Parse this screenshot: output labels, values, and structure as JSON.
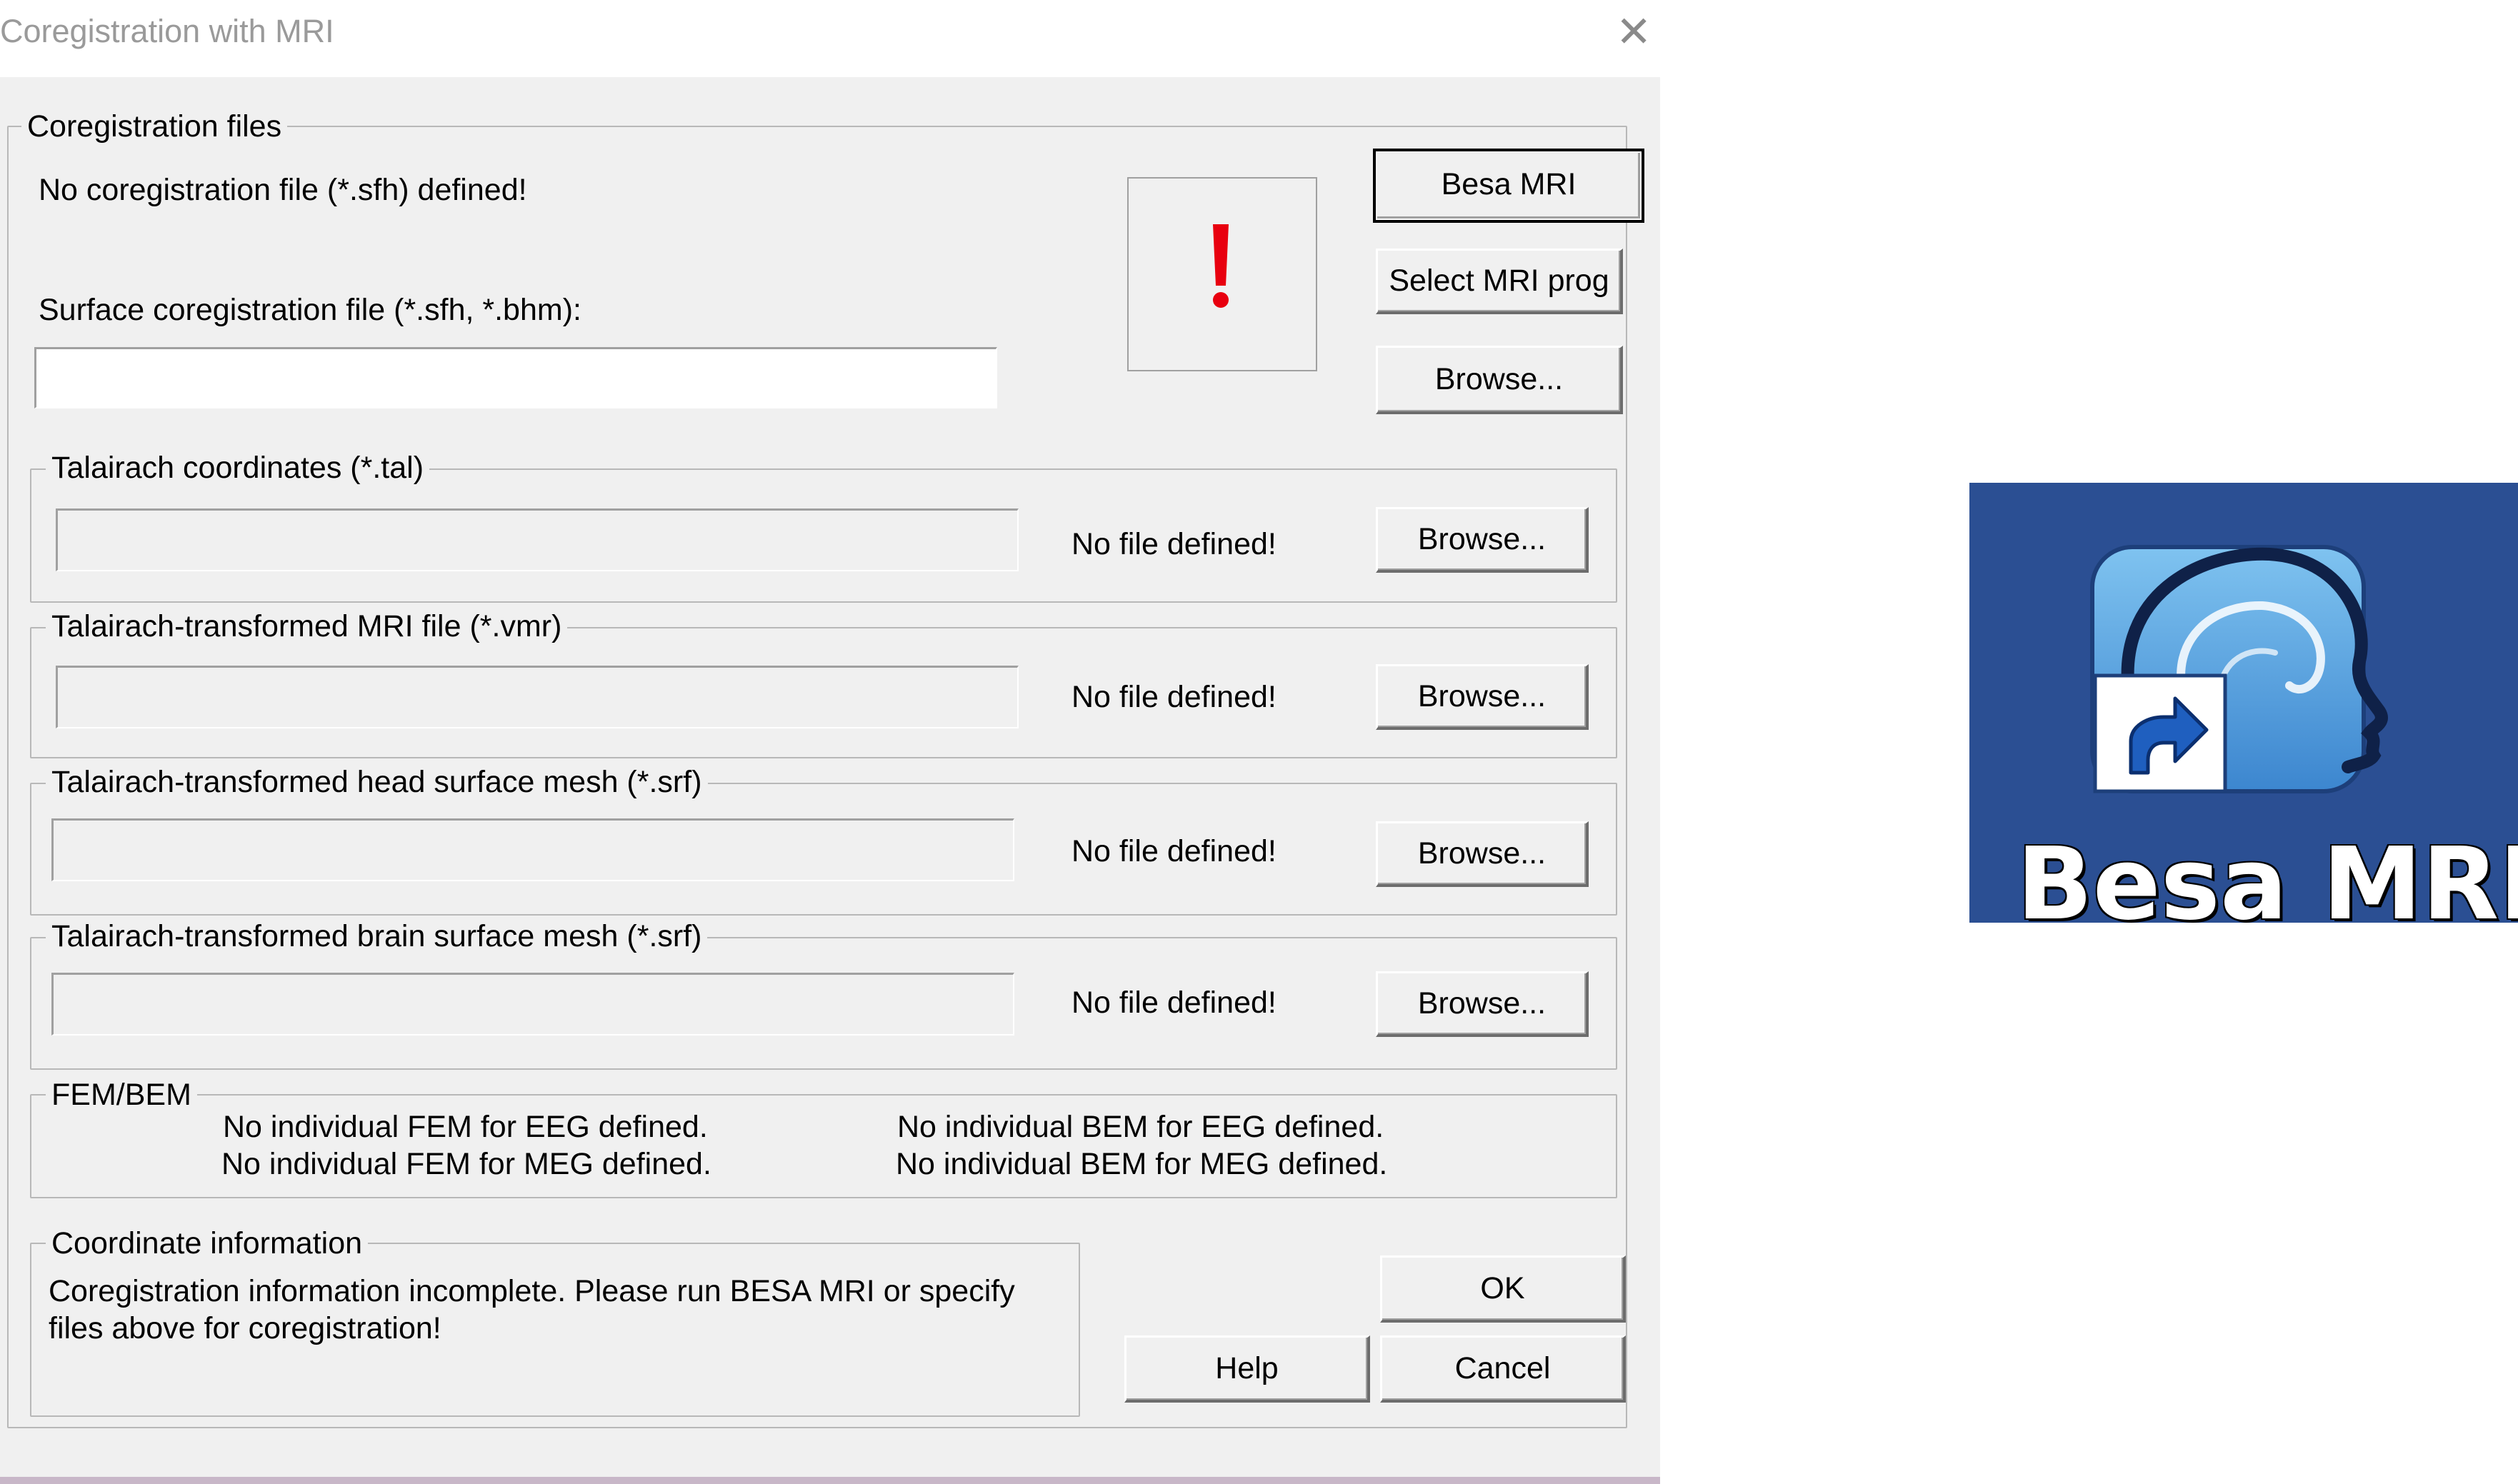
{
  "window": {
    "title": "Coregistration with MRI",
    "close_glyph": "✕"
  },
  "coreg_group": {
    "label": "Coregistration files",
    "status": "No coregistration file (*.sfh) defined!",
    "surface_label": "Surface coregistration file (*.sfh, *.bhm):",
    "surface_value": "",
    "warning_glyph": "!",
    "warning_color": "#e8000f",
    "besa_mri_button": "Besa MRI",
    "select_prog_button": "Select MRI prog",
    "browse_button": "Browse..."
  },
  "file_groups": [
    {
      "label": "Talairach coordinates (*.tal)",
      "value": "",
      "status": "No file defined!",
      "button": "Browse..."
    },
    {
      "label": "Talairach-transformed MRI file (*.vmr)",
      "value": "",
      "status": "No file defined!",
      "button": "Browse..."
    },
    {
      "label": "Talairach-transformed head surface mesh (*.srf)",
      "value": "",
      "status": "No file defined!",
      "button": "Browse..."
    },
    {
      "label": "Talairach-transformed brain surface mesh (*.srf)",
      "value": "",
      "status": "No file defined!",
      "button": "Browse..."
    }
  ],
  "fem_bem": {
    "label": "FEM/BEM",
    "fem_eeg": "No individual FEM for EEG defined.",
    "fem_meg": "No individual FEM for MEG defined.",
    "bem_eeg": "No individual BEM for EEG defined.",
    "bem_meg": "No individual BEM for MEG defined."
  },
  "coord_info": {
    "label": "Coordinate information",
    "line1": "Coregistration information incomplete. Please run BESA MRI or specify",
    "line2": "files above for coregistration!"
  },
  "buttons": {
    "ok": "OK",
    "help": "Help",
    "cancel": "Cancel"
  },
  "desktop_icon": {
    "label": "Besa MRI",
    "icon": "besa-mri-head-icon",
    "shortcut_icon": "shortcut-arrow-icon",
    "background": "#2b4f93"
  }
}
